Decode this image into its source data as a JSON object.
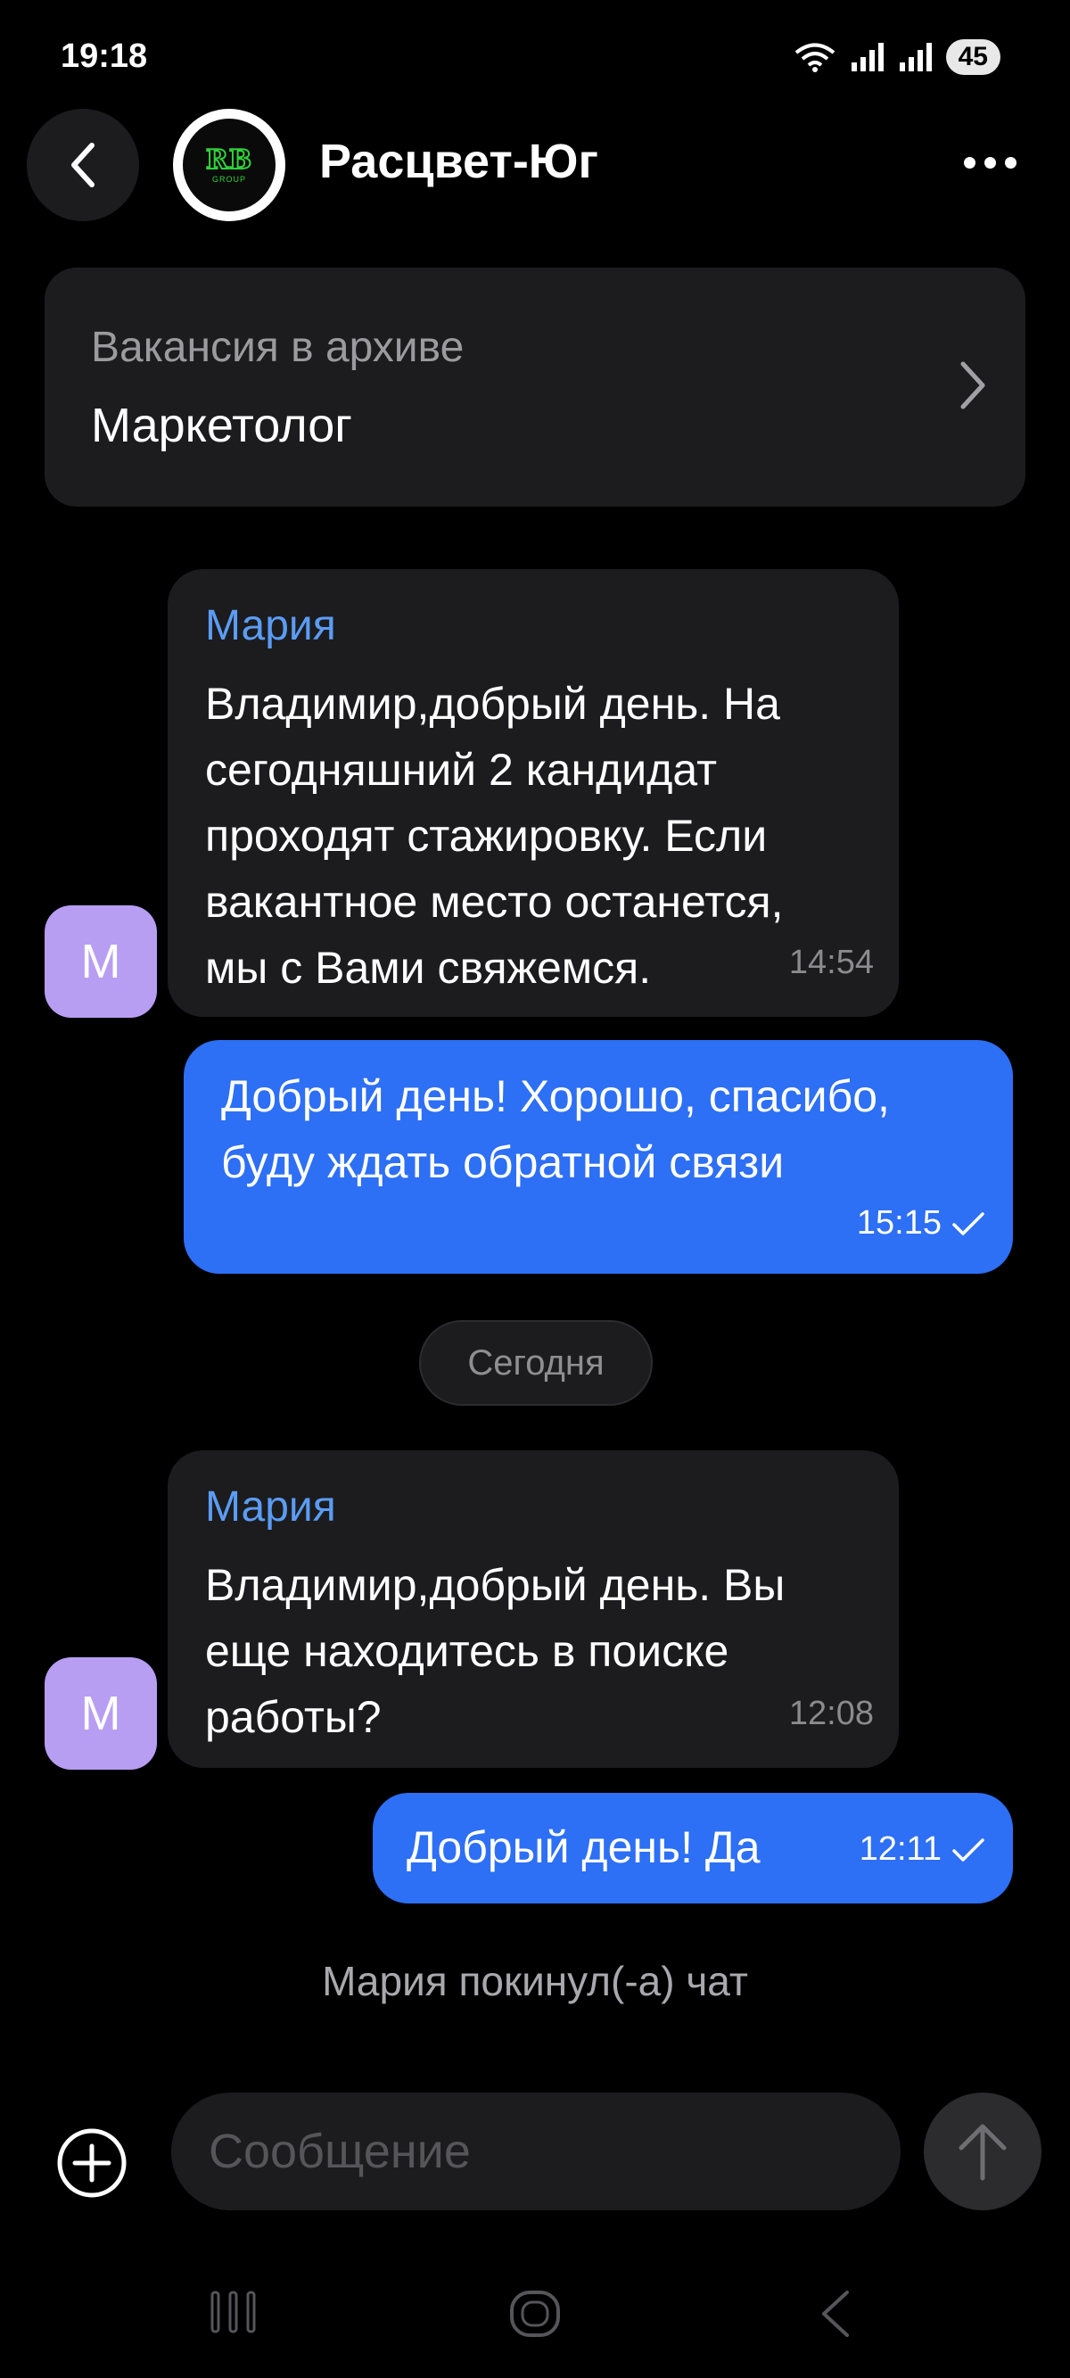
{
  "status_bar": {
    "time": "19:18",
    "battery": "45"
  },
  "header": {
    "title": "Расцвет-Юг",
    "logo_text": "RB",
    "logo_subtext": "GROUP"
  },
  "vacancy": {
    "subtitle": "Вакансия в архиве",
    "title": "Маркетолог"
  },
  "messages": [
    {
      "sender": "Мария",
      "avatar": "М",
      "lines": [
        "Владимир,добрый день. На",
        "сегодняшний 2 кандидат",
        "проходят стажировку. Если",
        "вакантное место останется,",
        "мы с Вами свяжемся."
      ],
      "time": "14:54"
    },
    {
      "lines": [
        "Добрый день! Хорошо, спасибо,",
        "буду ждать обратной связи"
      ],
      "time": "15:15"
    },
    {
      "sender": "Мария",
      "avatar": "М",
      "lines": [
        "Владимир,добрый день. Вы",
        "еще находитесь в поиске",
        "работы?"
      ],
      "time": "12:08"
    },
    {
      "lines": [
        "Добрый день! Да"
      ],
      "time": "12:11"
    }
  ],
  "date_separator": "Сегодня",
  "system_note": "Мария покинул(-а) чат",
  "composer": {
    "placeholder": "Сообщение"
  },
  "colors": {
    "background": "#000000",
    "incoming_bubble": "#1c1c1e",
    "outgoing_bubble": "#2d6ff5",
    "sender_name": "#5b9cf5",
    "avatar": "#b79ef3"
  },
  "icons": [
    "back-chevron-icon",
    "more-icon",
    "chevron-right-icon",
    "check-icon",
    "plus-circle-icon",
    "arrow-up-icon",
    "recent-apps-icon",
    "home-icon",
    "back-nav-icon",
    "wifi-icon",
    "signal-icon"
  ]
}
